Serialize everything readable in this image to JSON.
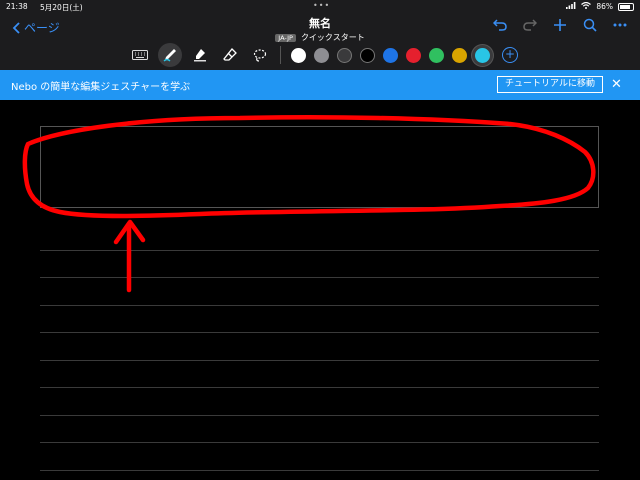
{
  "status_bar": {
    "time": "21:38",
    "date": "5月20日(土)",
    "battery": "86%",
    "battery_level": 0.86
  },
  "toolbar": {
    "back_label": "ページ",
    "doc_title": "無名",
    "lang_badge": "JA-JP",
    "subtitle": "クイックスタート"
  },
  "palette": {
    "colors": [
      "#ffffff",
      "#8e8e93",
      "#3a3a3c",
      "#000000",
      "#1e74e6",
      "#e5202e",
      "#30c060",
      "#d9a400",
      "#29c5e6"
    ],
    "selected": "#29c5e6"
  },
  "banner": {
    "text": "Nebo の簡単な編集ジェスチャーを学ぶ",
    "button_label": "チュートリアルに移動"
  },
  "annotation": {
    "color": "#ff0000"
  }
}
